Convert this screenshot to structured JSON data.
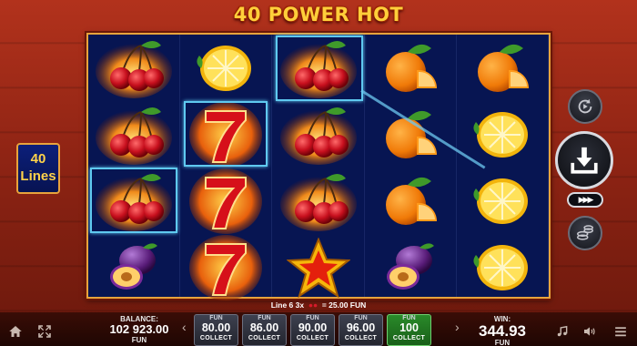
{
  "title": "40 POWER HOT",
  "lines_badge": {
    "value": "40",
    "label": "Lines"
  },
  "reels": [
    [
      "burning-cherries",
      "burning-cherries",
      "burning-cherries",
      "plum"
    ],
    [
      "lemon",
      "seven",
      "seven",
      "seven"
    ],
    [
      "burning-cherries",
      "burning-cherries",
      "burning-cherries",
      "star"
    ],
    [
      "orange",
      "orange",
      "orange",
      "plum"
    ],
    [
      "orange",
      "lemon",
      "lemon",
      "lemon"
    ]
  ],
  "win_line": {
    "text": "Line 6 3x",
    "amount": "= 25.00 FUN"
  },
  "balance": {
    "label": "BALANCE:",
    "value": "102 923.00",
    "unit": "FUN"
  },
  "chips": [
    {
      "label": "FUN",
      "value": "80.00",
      "action": "COLLECT",
      "active": false
    },
    {
      "label": "FUN",
      "value": "86.00",
      "action": "COLLECT",
      "active": false
    },
    {
      "label": "FUN",
      "value": "90.00",
      "action": "COLLECT",
      "active": false
    },
    {
      "label": "FUN",
      "value": "96.00",
      "action": "COLLECT",
      "active": false
    },
    {
      "label": "FUN",
      "value": "100",
      "action": "COLLECT",
      "active": true
    }
  ],
  "win": {
    "label": "WIN:",
    "value": "344.93",
    "unit": "FUN"
  },
  "ff_label": "▶▶▶",
  "colors": {
    "frame": "#e8a33c",
    "reel_bg": "#071552",
    "highlight": "#5fc9f0",
    "title": "#ffcf3a"
  },
  "icons": [
    "home-icon",
    "fullscreen-icon",
    "autoplay-icon",
    "spin-icon",
    "fast-forward-icon",
    "coins-icon",
    "music-icon",
    "sound-icon",
    "menu-icon"
  ]
}
